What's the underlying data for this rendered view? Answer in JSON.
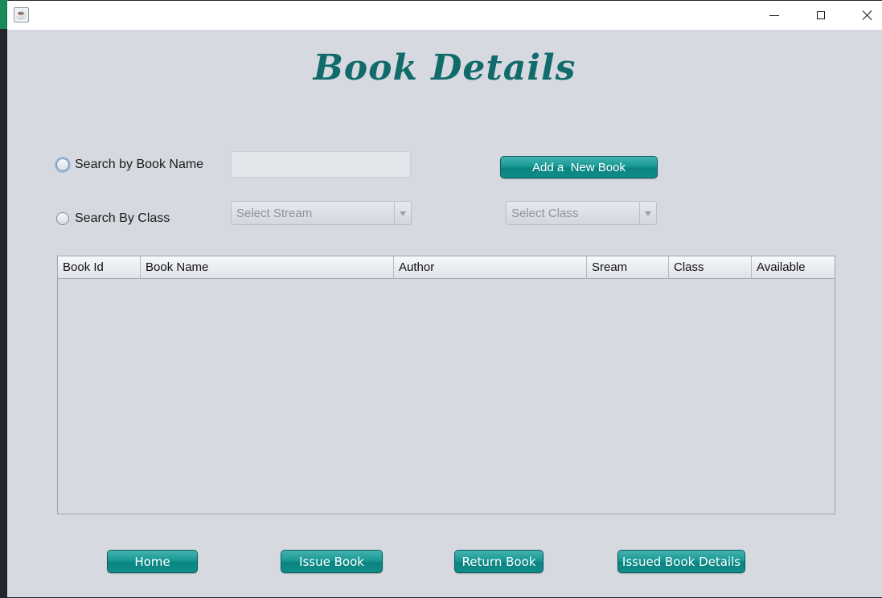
{
  "page": {
    "title": "Book Details"
  },
  "search": {
    "by_name_label": "Search by Book Name",
    "by_class_label": "Search By Class",
    "name_value": "",
    "stream_placeholder": "Select Stream",
    "class_placeholder": "Select Class"
  },
  "actions": {
    "add_label": "Add a  New Book"
  },
  "table": {
    "columns": [
      "Book Id",
      "Book Name",
      "Author",
      "Sream",
      "Class",
      "Available"
    ],
    "rows": []
  },
  "nav": {
    "home": "Home",
    "issue": "Issue Book",
    "return": "Return Book",
    "issued_details": "Issued Book Details"
  },
  "colors": {
    "accent": "#128f8b",
    "title": "#126b6b",
    "background": "#d6d9e0"
  }
}
